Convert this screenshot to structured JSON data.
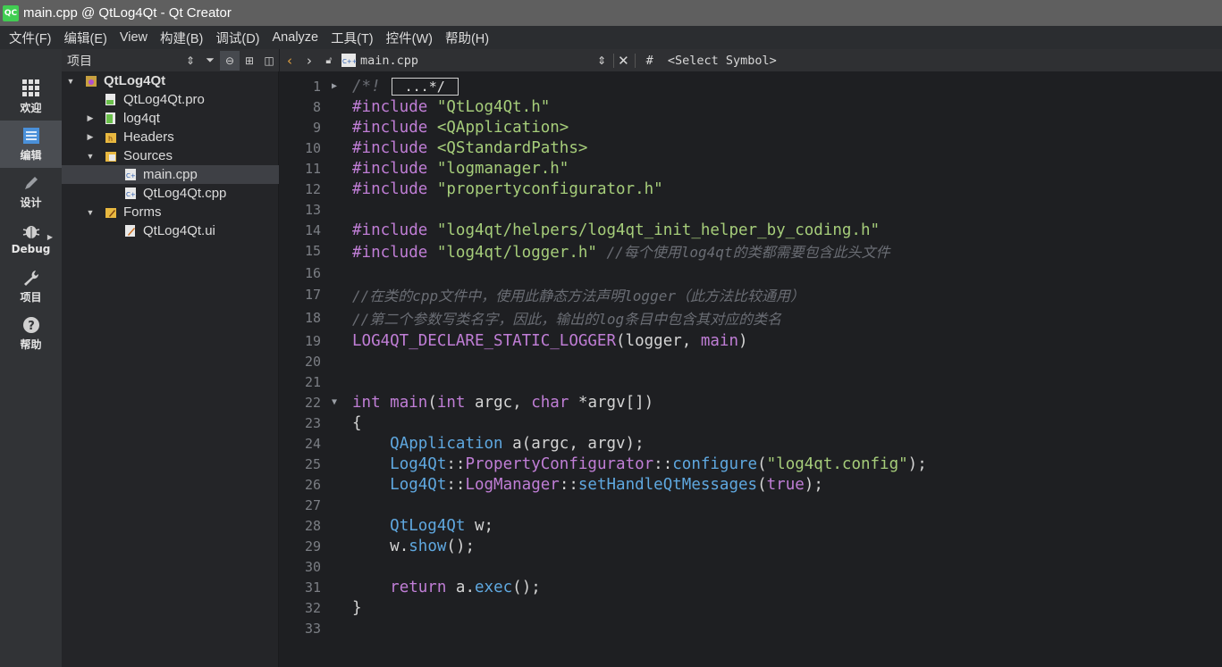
{
  "window": {
    "title": "main.cpp @ QtLog4Qt - Qt Creator",
    "logo": "QC"
  },
  "menu": [
    "文件(F)",
    "编辑(E)",
    "View",
    "构建(B)",
    "调试(D)",
    "Analyze",
    "工具(T)",
    "控件(W)",
    "帮助(H)"
  ],
  "modes": [
    {
      "label": "欢迎",
      "icon": "grid-icon"
    },
    {
      "label": "编辑",
      "icon": "edit-doc-icon"
    },
    {
      "label": "设计",
      "icon": "pencil-icon"
    },
    {
      "label": "Debug",
      "icon": "bug-icon"
    },
    {
      "label": "项目",
      "icon": "wrench-icon"
    },
    {
      "label": "帮助",
      "icon": "help-icon"
    }
  ],
  "project_panel": {
    "label": "项目",
    "tree": [
      {
        "label": "QtLog4Qt",
        "expanded": true
      },
      {
        "label": "QtLog4Qt.pro"
      },
      {
        "label": "log4qt",
        "expanded": false
      },
      {
        "label": "Headers",
        "expanded": false
      },
      {
        "label": "Sources",
        "expanded": true
      },
      {
        "label": "main.cpp",
        "selected": true
      },
      {
        "label": "QtLog4Qt.cpp"
      },
      {
        "label": "Forms",
        "expanded": true
      },
      {
        "label": "QtLog4Qt.ui"
      }
    ]
  },
  "editor_toolbar": {
    "file": "main.cpp",
    "hash": "#",
    "symbol": "<Select Symbol>"
  },
  "editor": {
    "folded_text": "...*/",
    "line_numbers": [
      "1",
      "8",
      "9",
      "10",
      "11",
      "12",
      "13",
      "14",
      "15",
      "16",
      "17",
      "18",
      "19",
      "20",
      "21",
      "22",
      "23",
      "24",
      "25",
      "26",
      "27",
      "28",
      "29",
      "30",
      "31",
      "32",
      "33"
    ],
    "tokens": {
      "l1_comment": "/*!",
      "include": "#include",
      "l8": "\"QtLog4Qt.h\"",
      "l9": "<QApplication>",
      "l10": "<QStandardPaths>",
      "l11": "\"logmanager.h\"",
      "l12": "\"propertyconfigurator.h\"",
      "l14": "\"log4qt/helpers/log4qt_init_helper_by_coding.h\"",
      "l15": "\"log4qt/logger.h\"",
      "l15_comment": "//每个使用log4qt的类都需要包含此头文件",
      "l17": "//在类的cpp文件中，使用此静态方法声明logger（此方法比较通用）",
      "l18": "//第二个参数写类名字，因此，输出的log条目中包含其对应的类名",
      "l19_macro": "LOG4QT_DECLARE_STATIC_LOGGER",
      "l19_open": "(logger, ",
      "l19_main": "main",
      "l19_close": ")",
      "kw_int": "int",
      "kw_main": "main",
      "l22_a": "(",
      "l22_b": " argc, ",
      "kw_char": "char",
      "l22_c": " *argv[])",
      "brace_open": "{",
      "brace_close": "}",
      "l24_type": "QApplication",
      "l24_rest": " a(argc, argv);",
      "ns_log4qt": "Log4Qt",
      "scope": "::",
      "l25_class": "PropertyConfigurator",
      "l25_fn": "configure",
      "l25_str": "\"log4qt.config\"",
      "paren_open": "(",
      "paren_close_semi": ");",
      "l26_class": "LogManager",
      "l26_fn": "setHandleQtMessages",
      "l26_true": "true",
      "l28_type": "QtLog4Qt",
      "l28_rest": " w;",
      "l29_obj": "w",
      "dot": ".",
      "l29_fn": "show",
      "call_semi": "();",
      "kw_return": "return",
      "l31_obj": " a",
      "l31_fn": "exec"
    }
  }
}
